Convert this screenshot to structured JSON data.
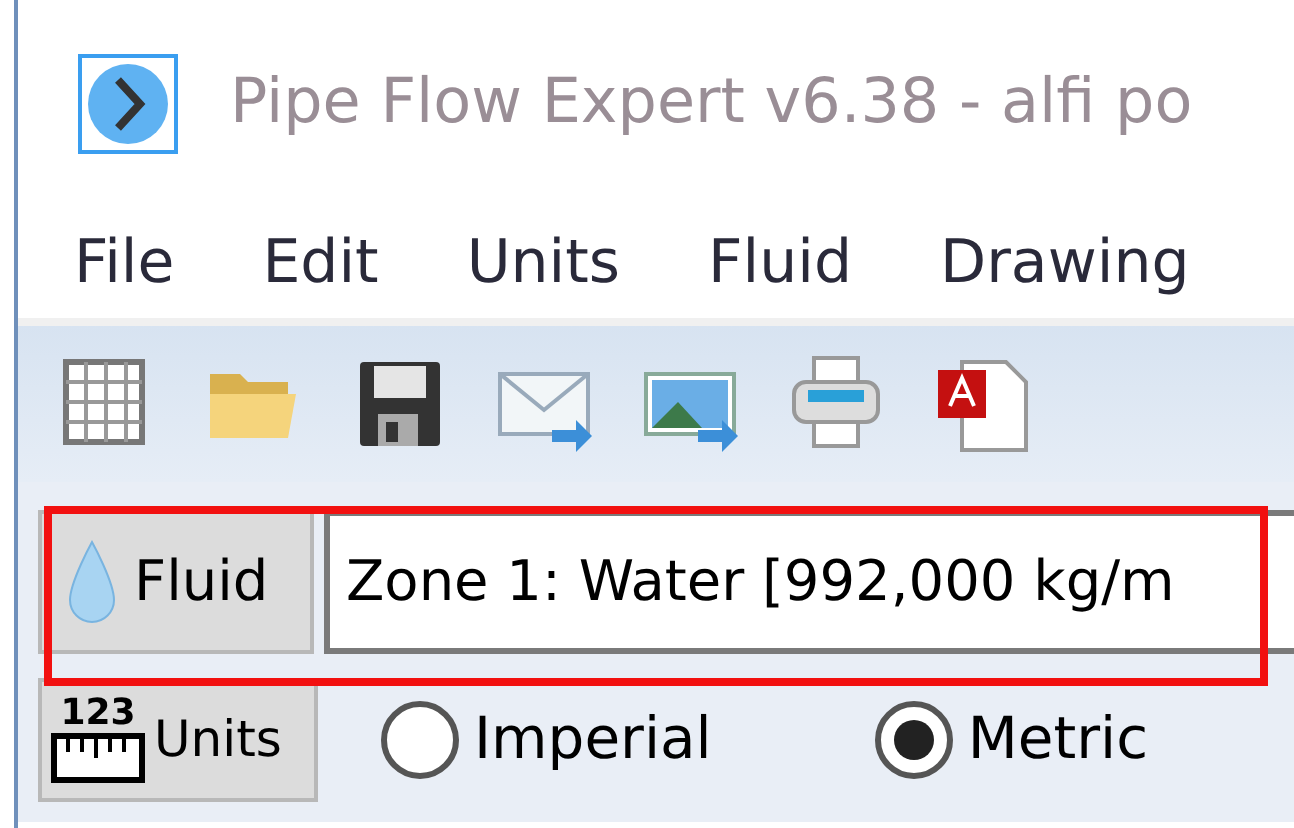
{
  "window": {
    "title": "Pipe Flow Expert v6.38 - alfi po"
  },
  "menu": [
    {
      "label": "File"
    },
    {
      "label": "Edit"
    },
    {
      "label": "Units"
    },
    {
      "label": "Fluid"
    },
    {
      "label": "Drawing"
    }
  ],
  "fluid": {
    "button": "Fluid",
    "value": "Zone 1: Water [992,000 kg/m"
  },
  "units": {
    "button": "Units",
    "icon_text": "123",
    "options": [
      {
        "label": "Imperial",
        "selected": false
      },
      {
        "label": "Metric",
        "selected": true
      }
    ]
  }
}
